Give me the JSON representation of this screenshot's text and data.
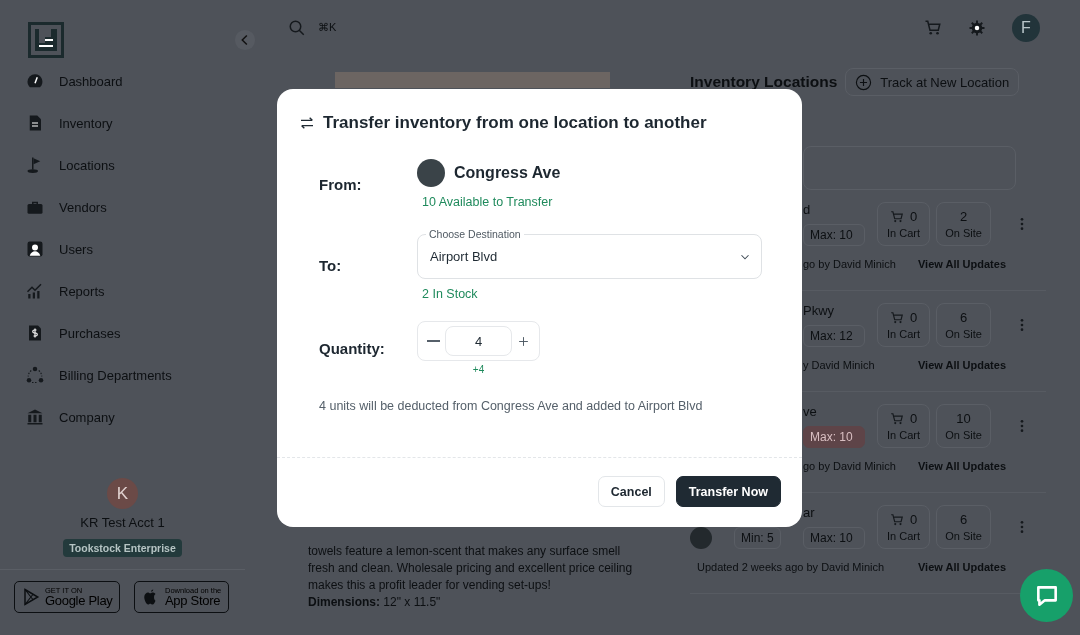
{
  "sidebar": {
    "items": [
      {
        "label": "Dashboard"
      },
      {
        "label": "Inventory"
      },
      {
        "label": "Locations"
      },
      {
        "label": "Vendors"
      },
      {
        "label": "Users"
      },
      {
        "label": "Reports"
      },
      {
        "label": "Purchases"
      },
      {
        "label": "Billing Departments"
      },
      {
        "label": "Company"
      }
    ],
    "account": {
      "initial": "K",
      "name": "KR Test Acct 1",
      "plan": "Tookstock Enterprise"
    },
    "store_badges": [
      {
        "kind": "google",
        "small": "GET IT ON",
        "big": "Google Play"
      },
      {
        "kind": "apple",
        "small": "Download on the",
        "big": "App Store"
      }
    ]
  },
  "topbar": {
    "shortcut": "⌘K",
    "avatar_initial": "F"
  },
  "product": {
    "description": "towels feature a lemon-scent that makes any surface smell fresh and clean. Wholesale pricing and excellent price ceiling makes this a profit leader for vending set-ups!",
    "dimensions": "**Dimensions:** 12\" x 11.5\""
  },
  "locations_panel": {
    "title": "Inventory Locations",
    "track_button": "Track at New Location",
    "rows": [
      {
        "name": "d",
        "max_label": "Max:",
        "max": "10",
        "max_alert": false,
        "in_cart": "0",
        "in_cart_label": "In Cart",
        "on_site": "2",
        "on_site_label": "On Site",
        "updated": "go by David Minich",
        "link": "View All Updates"
      },
      {
        "name": "Pkwy",
        "max_label": "Max:",
        "max": "12",
        "max_alert": false,
        "in_cart": "0",
        "in_cart_label": "In Cart",
        "on_site": "6",
        "on_site_label": "On Site",
        "updated": "y David Minich",
        "link": "View All Updates"
      },
      {
        "name": "ve",
        "max_label": "Max:",
        "max": "10",
        "max_alert": true,
        "in_cart": "0",
        "in_cart_label": "In Cart",
        "on_site": "10",
        "on_site_label": "On Site",
        "updated": "go by David Minich",
        "link": "View All Updates"
      },
      {
        "name": "ar",
        "photo": true,
        "min_label": "Min:",
        "min": "5",
        "max_label": "Max:",
        "max": "10",
        "max_alert": false,
        "in_cart": "0",
        "in_cart_label": "In Cart",
        "on_site": "6",
        "on_site_label": "On Site",
        "updated": "Updated 2 weeks ago by David Minich",
        "link": "View All Updates"
      }
    ]
  },
  "modal": {
    "title": "Transfer inventory from one location to another",
    "from_label": "From:",
    "from_name": "Congress Ave",
    "from_note": "10 Available to Transfer",
    "to_label": "To:",
    "destination": {
      "label": "Choose Destination",
      "value": "Airport Blvd"
    },
    "to_note": "2 In Stock",
    "quantity_label": "Quantity:",
    "quantity": "4",
    "quantity_delta": "+4",
    "summary": "4 units will be deducted from Congress Ave and added to Airport Blvd",
    "buttons": [
      {
        "label": "Cancel",
        "kind": "secondary"
      },
      {
        "label": "Transfer Now",
        "kind": "primary"
      }
    ]
  }
}
